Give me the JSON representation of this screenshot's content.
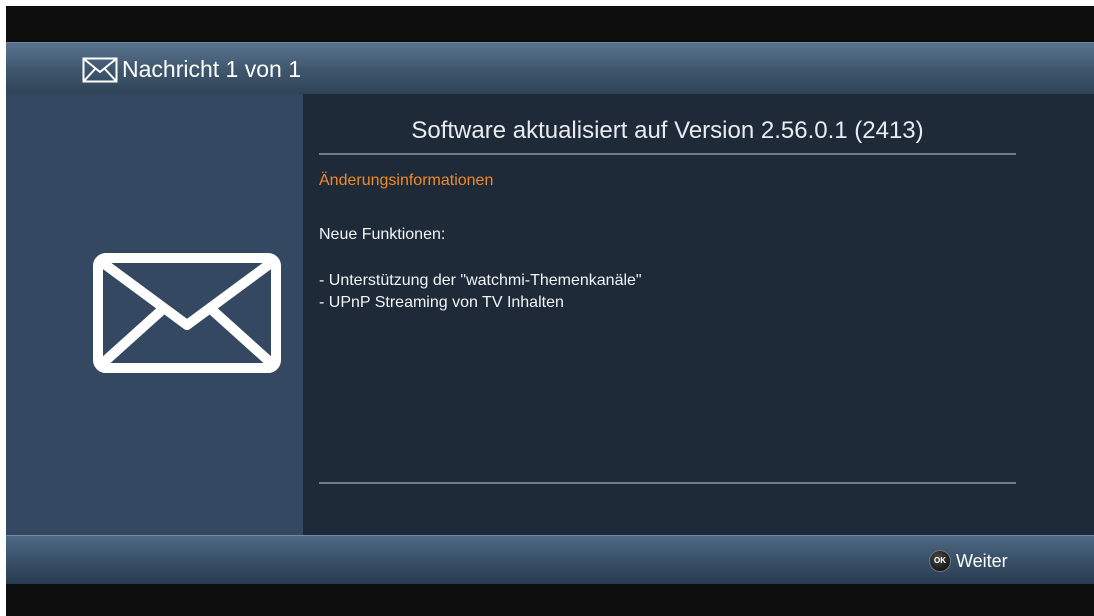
{
  "header": {
    "icon": "envelope-icon",
    "title": "Nachricht 1 von 1"
  },
  "left_panel": {
    "icon": "envelope-icon"
  },
  "message": {
    "title": "Software aktualisiert auf Version  2.56.0.1 (2413)",
    "section_heading": "Änderungsinformationen",
    "lines": [
      "Neue Funktionen:",
      "- Unterstützung der \"watchmi-Themenkanäle\"",
      "- UPnP Streaming von TV Inhalten"
    ]
  },
  "footer": {
    "ok_badge": "OK",
    "continue_label": "Weiter"
  },
  "colors": {
    "accent": "#f08a28",
    "header_blue": "#40586f",
    "panel_blue": "#344961",
    "background": "#1f2a39"
  }
}
